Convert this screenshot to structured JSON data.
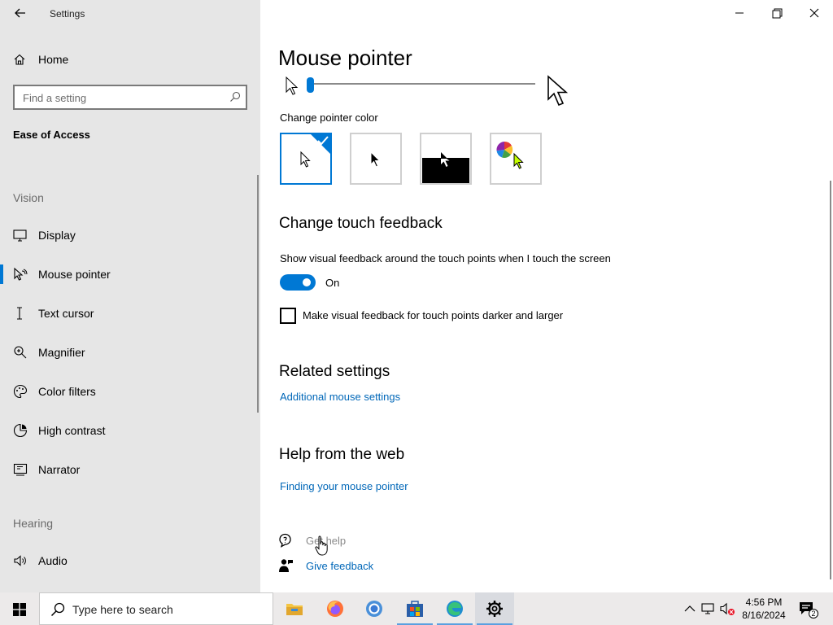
{
  "window": {
    "title": "Settings",
    "controls": {
      "minimize": "minimize-icon",
      "maximize": "restore-icon",
      "close": "close-icon"
    }
  },
  "sidebar": {
    "home_label": "Home",
    "search_placeholder": "Find a setting",
    "section_title": "Ease of Access",
    "groups": [
      {
        "title": "Vision",
        "items": [
          {
            "label": "Display",
            "icon": "monitor-icon"
          },
          {
            "label": "Mouse pointer",
            "icon": "mouse-pointer-icon",
            "active": true
          },
          {
            "label": "Text cursor",
            "icon": "text-cursor-icon"
          },
          {
            "label": "Magnifier",
            "icon": "magnifier-icon"
          },
          {
            "label": "Color filters",
            "icon": "color-filters-icon"
          },
          {
            "label": "High contrast",
            "icon": "high-contrast-icon"
          },
          {
            "label": "Narrator",
            "icon": "narrator-icon"
          }
        ]
      },
      {
        "title": "Hearing",
        "items": [
          {
            "label": "Audio",
            "icon": "speaker-icon"
          }
        ]
      }
    ]
  },
  "main": {
    "page_title": "Mouse pointer",
    "pointer_size_level": 0.0,
    "pointer_color": {
      "label": "Change pointer color",
      "options": [
        "white",
        "black",
        "inverted",
        "custom"
      ],
      "selected": "white"
    },
    "touch_feedback": {
      "heading": "Change touch feedback",
      "description": "Show visual feedback around the touch points when I touch the screen",
      "toggle_state": "On",
      "toggle_on": true,
      "darker_label": "Make visual feedback for touch points darker and larger",
      "darker_checked": false
    },
    "related": {
      "heading": "Related settings",
      "link": "Additional mouse settings"
    },
    "help": {
      "heading": "Help from the web",
      "link": "Finding your mouse pointer"
    },
    "support": {
      "get_help": "Get help",
      "give_feedback": "Give feedback"
    }
  },
  "taskbar": {
    "search_placeholder": "Type here to search",
    "apps": [
      "file-explorer-icon",
      "firefox-icon",
      "chrome-icon",
      "microsoft-store-icon",
      "edge-icon",
      "settings-gear-icon"
    ],
    "time": "4:56 PM",
    "date": "8/16/2024",
    "notification_count": "2"
  },
  "colors": {
    "accent": "#0078d4",
    "link": "#0067b8",
    "sidebar_bg": "#e6e6e6"
  }
}
